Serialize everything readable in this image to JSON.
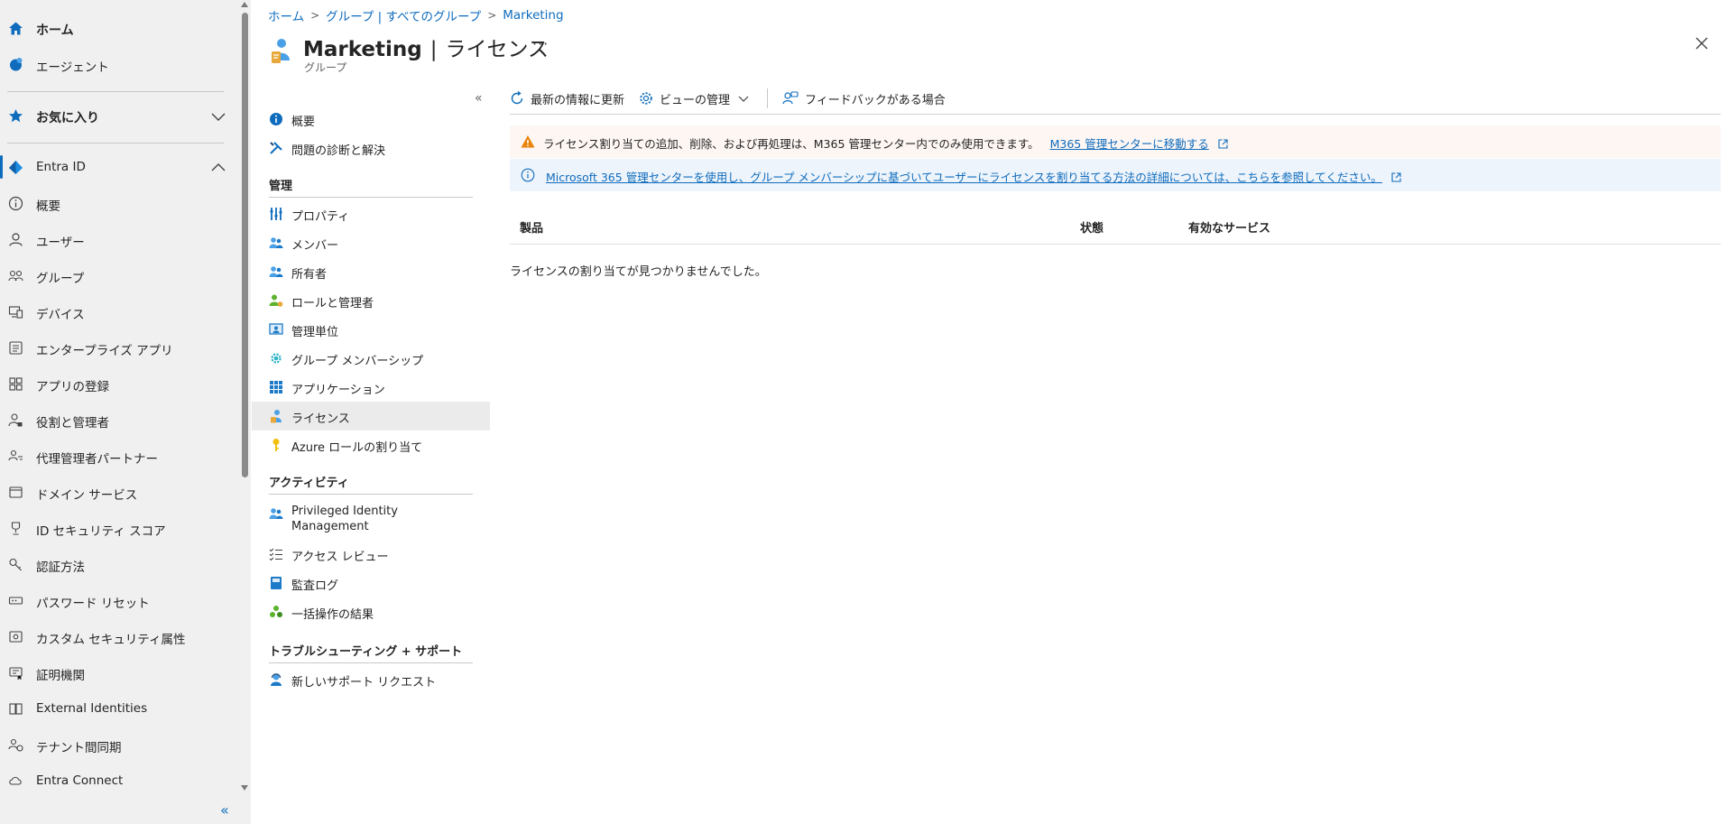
{
  "leftnav": {
    "home": "ホーム",
    "agent": "エージェント",
    "favorites": "お気に入り",
    "entra": "Entra ID",
    "items": [
      "概要",
      "ユーザー",
      "グループ",
      "デバイス",
      "エンタープライズ アプリ",
      "アプリの登録",
      "役割と管理者",
      "代理管理者パートナー",
      "ドメイン サービス",
      "ID セキュリティ スコア",
      "認証方法",
      "パスワード リセット",
      "カスタム セキュリティ属性",
      "証明機関",
      "External Identities",
      "テナント間同期",
      "Entra Connect"
    ],
    "collapse_glyph": "«"
  },
  "breadcrumb": [
    "ホーム",
    "グループ | すべてのグループ",
    "Marketing"
  ],
  "header": {
    "name": "Marketing",
    "separator": "|",
    "section": "ライセンス",
    "subtitle": "グループ",
    "more": "···"
  },
  "resmenu": {
    "collapse_glyph": "«",
    "top_items": [
      "概要",
      "問題の診断と解決"
    ],
    "sections": [
      {
        "title": "管理",
        "items": [
          "プロパティ",
          "メンバー",
          "所有者",
          "ロールと管理者",
          "管理単位",
          "グループ メンバーシップ",
          "アプリケーション",
          "ライセンス",
          "Azure ロールの割り当て"
        ]
      },
      {
        "title": "アクティビティ",
        "items": [
          "Privileged Identity Management",
          "アクセス レビュー",
          "監査ログ",
          "一括操作の結果"
        ]
      },
      {
        "title": "トラブルシューティング + サポート",
        "items": [
          "新しいサポート リクエスト"
        ]
      }
    ],
    "selected": "ライセンス"
  },
  "toolbar": {
    "refresh": "最新の情報に更新",
    "manage_view": "ビューの管理",
    "feedback": "フィードバックがある場合"
  },
  "warning_banner": {
    "text": "ライセンス割り当ての追加、削除、および再処理は、M365 管理センター内でのみ使用できます。",
    "link": "M365 管理センターに移動する"
  },
  "info_banner": {
    "link": "Microsoft 365 管理センターを使用し、グループ メンバーシップに基づいてユーザーにライセンスを割り当てる方法の詳細については、こちらを参照してください。"
  },
  "grid": {
    "columns": [
      "製品",
      "状態",
      "有効なサービス"
    ],
    "empty_message": "ライセンスの割り当てが見つかりませんでした。"
  },
  "colors": {
    "accent": "#0f6cbd",
    "warning": "#e9830b",
    "warning_bg": "#fdf6f3",
    "info_bg": "#eef4fb"
  }
}
